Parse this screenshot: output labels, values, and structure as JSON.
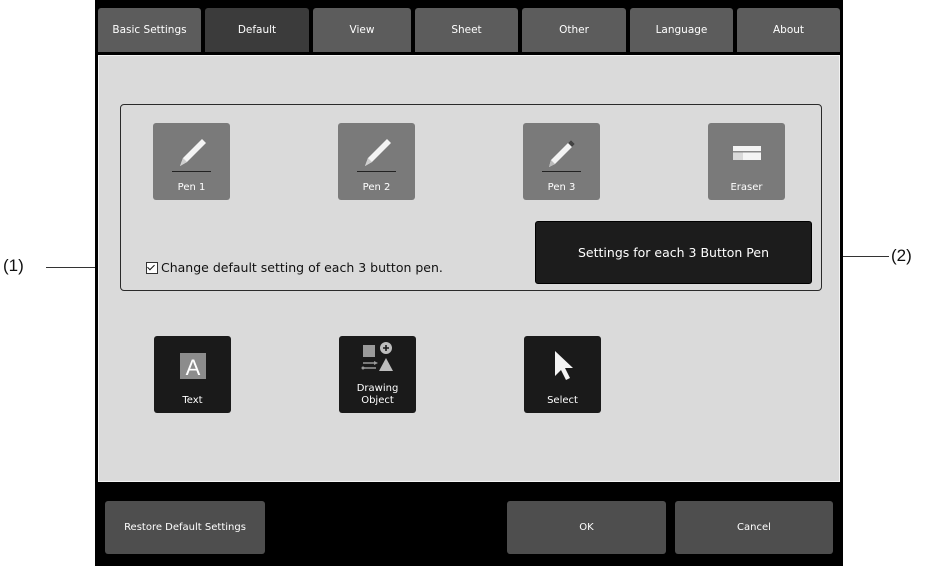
{
  "tabs": [
    "Basic Settings",
    "Default",
    "View",
    "Sheet",
    "Other",
    "Language",
    "About"
  ],
  "active_tab": "Default",
  "pen_tools": [
    {
      "label": "Pen 1",
      "icon": "pen-icon"
    },
    {
      "label": "Pen 2",
      "icon": "pen-icon"
    },
    {
      "label": "Pen 3",
      "icon": "marker-icon"
    },
    {
      "label": "Eraser",
      "icon": "eraser-icon"
    }
  ],
  "checkbox": {
    "label": "Change default setting of each 3 button pen.",
    "checked": true
  },
  "settings_button": "Settings for each 3 Button Pen",
  "other_tools": [
    {
      "label": "Text",
      "icon": "text-icon"
    },
    {
      "label": "Drawing Object",
      "icon": "shapes-icon"
    },
    {
      "label": "Select",
      "icon": "cursor-icon"
    }
  ],
  "buttons": {
    "restore": "Restore Default Settings",
    "ok": "OK",
    "cancel": "Cancel"
  },
  "callouts": {
    "left": "(1)",
    "right": "(2)"
  }
}
